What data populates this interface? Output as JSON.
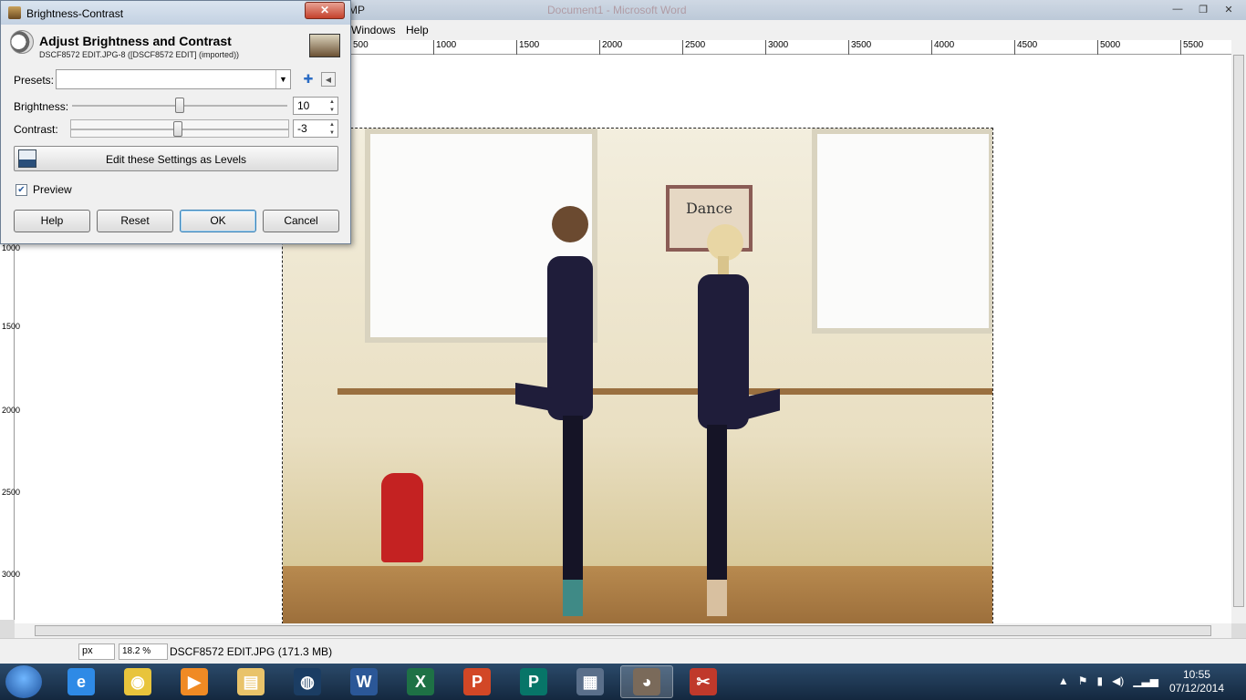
{
  "main_window": {
    "title_fragment": "MP",
    "background_title": "Document1 - Microsoft Word",
    "controls": [
      "—",
      "❐",
      "✕"
    ]
  },
  "menubar": {
    "items": [
      "Windows",
      "Help"
    ]
  },
  "ruler": {
    "top_ticks": [
      "500",
      "1000",
      "1500",
      "2000",
      "2500",
      "3000",
      "3500",
      "4000",
      "4500",
      "5000",
      "5500"
    ],
    "left_ticks": [
      "1000",
      "1500",
      "2000",
      "2500",
      "3000"
    ]
  },
  "image": {
    "sign_text": "Dance"
  },
  "statusbar": {
    "unit": "px",
    "zoom": "18.2 %",
    "file_info": "DSCF8572 EDIT.JPG (171.3 MB)"
  },
  "taskbar": {
    "apps": [
      {
        "name": "internet-explorer",
        "glyph": "e",
        "color": "#2e8ae6"
      },
      {
        "name": "chrome",
        "glyph": "◉",
        "color": "#e8c43c"
      },
      {
        "name": "media-player",
        "glyph": "▶",
        "color": "#f08a24"
      },
      {
        "name": "file-explorer",
        "glyph": "▤",
        "color": "#e9c36a"
      },
      {
        "name": "steam",
        "glyph": "◍",
        "color": "#1b3d63"
      },
      {
        "name": "word",
        "glyph": "W",
        "color": "#2b5797"
      },
      {
        "name": "excel",
        "glyph": "X",
        "color": "#1e7145"
      },
      {
        "name": "powerpoint",
        "glyph": "P",
        "color": "#d24726"
      },
      {
        "name": "publisher",
        "glyph": "P",
        "color": "#077568"
      },
      {
        "name": "notes",
        "glyph": "▦",
        "color": "#5a6f8a"
      },
      {
        "name": "gimp",
        "glyph": "◕",
        "color": "#7a6a5a",
        "active": true
      },
      {
        "name": "snipping-tool",
        "glyph": "✂",
        "color": "#c0392b"
      }
    ],
    "tray": [
      "▲",
      "⚑",
      "▮",
      "◀)",
      "▁▃▅"
    ],
    "time": "10:55",
    "date": "07/12/2014"
  },
  "dialog": {
    "title": "Brightness-Contrast",
    "close": "✕",
    "header_title": "Adjust Brightness and Contrast",
    "header_subtitle": "DSCF8572 EDIT.JPG-8 ([DSCF8572 EDIT] (imported))",
    "presets_label": "Presets:",
    "presets_value": "",
    "brightness_label": "Brightness:",
    "brightness_value": "10",
    "brightness_level": 0.5,
    "contrast_label": "Contrast:",
    "contrast_value": "-3",
    "contrast_level": 0.49,
    "levels_button": "Edit these Settings as Levels",
    "preview_label": "Preview",
    "preview_checked": true,
    "buttons": {
      "help": "Help",
      "reset": "Reset",
      "ok": "OK",
      "cancel": "Cancel"
    }
  }
}
